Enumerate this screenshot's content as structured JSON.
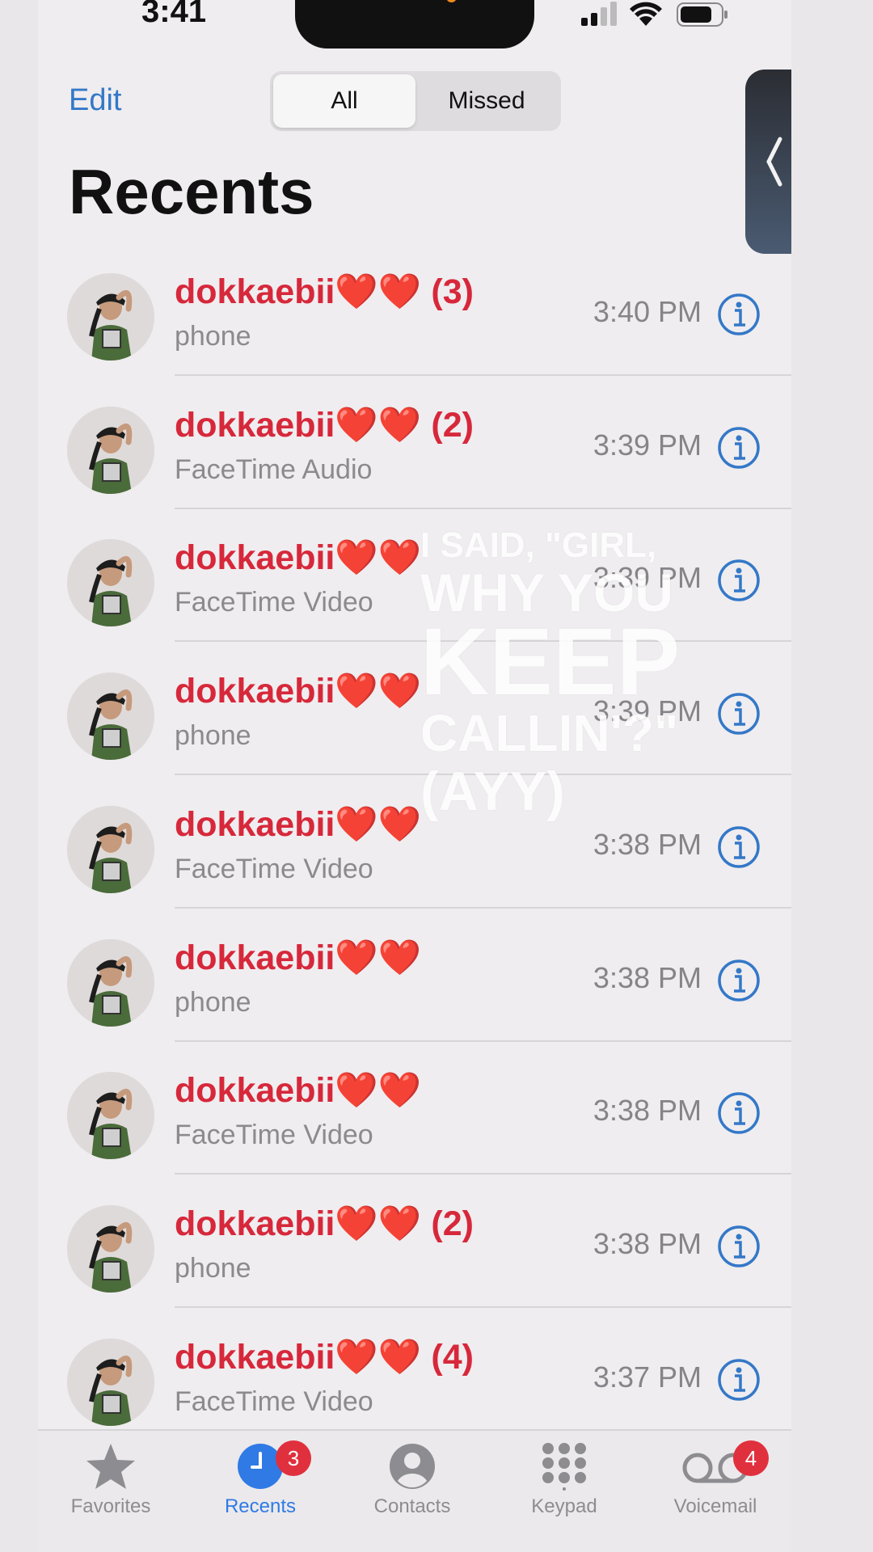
{
  "status": {
    "time": "3:41"
  },
  "header": {
    "edit_label": "Edit",
    "segments": [
      "All",
      "Missed"
    ],
    "selected_segment": "All",
    "title": "Recents"
  },
  "calls": [
    {
      "name": "dokkaebii❤️❤️ (3)",
      "type": "phone",
      "time": "3:40 PM"
    },
    {
      "name": "dokkaebii❤️❤️ (2)",
      "type": "FaceTime Audio",
      "time": "3:39 PM"
    },
    {
      "name": "dokkaebii❤️❤️",
      "type": "FaceTime Video",
      "time": "3:39 PM"
    },
    {
      "name": "dokkaebii❤️❤️",
      "type": "phone",
      "time": "3:39 PM"
    },
    {
      "name": "dokkaebii❤️❤️",
      "type": "FaceTime Video",
      "time": "3:38 PM"
    },
    {
      "name": "dokkaebii❤️❤️",
      "type": "phone",
      "time": "3:38 PM"
    },
    {
      "name": "dokkaebii❤️❤️",
      "type": "FaceTime Video",
      "time": "3:38 PM"
    },
    {
      "name": "dokkaebii❤️❤️ (2)",
      "type": "phone",
      "time": "3:38 PM"
    },
    {
      "name": "dokkaebii❤️❤️ (4)",
      "type": "FaceTime Video",
      "time": "3:37 PM"
    }
  ],
  "overlay_lyrics": [
    "I SAID, \"GIRL,",
    "WHY YOU",
    "KEEP",
    "CALLIN'?\"",
    "(AYY)"
  ],
  "tabs": [
    {
      "label": "Favorites",
      "icon": "star-icon",
      "active": false
    },
    {
      "label": "Recents",
      "icon": "clock-icon",
      "active": true,
      "badge": "3"
    },
    {
      "label": "Contacts",
      "icon": "person-circle-icon",
      "active": false
    },
    {
      "label": "Keypad",
      "icon": "keypad-icon",
      "active": false
    },
    {
      "label": "Voicemail",
      "icon": "voicemail-icon",
      "active": false,
      "badge": "4"
    }
  ],
  "colors": {
    "accent": "#3478c8",
    "missed_red": "#d7283b",
    "badge_red": "#e0303e",
    "tab_active": "#2f7ae5"
  }
}
